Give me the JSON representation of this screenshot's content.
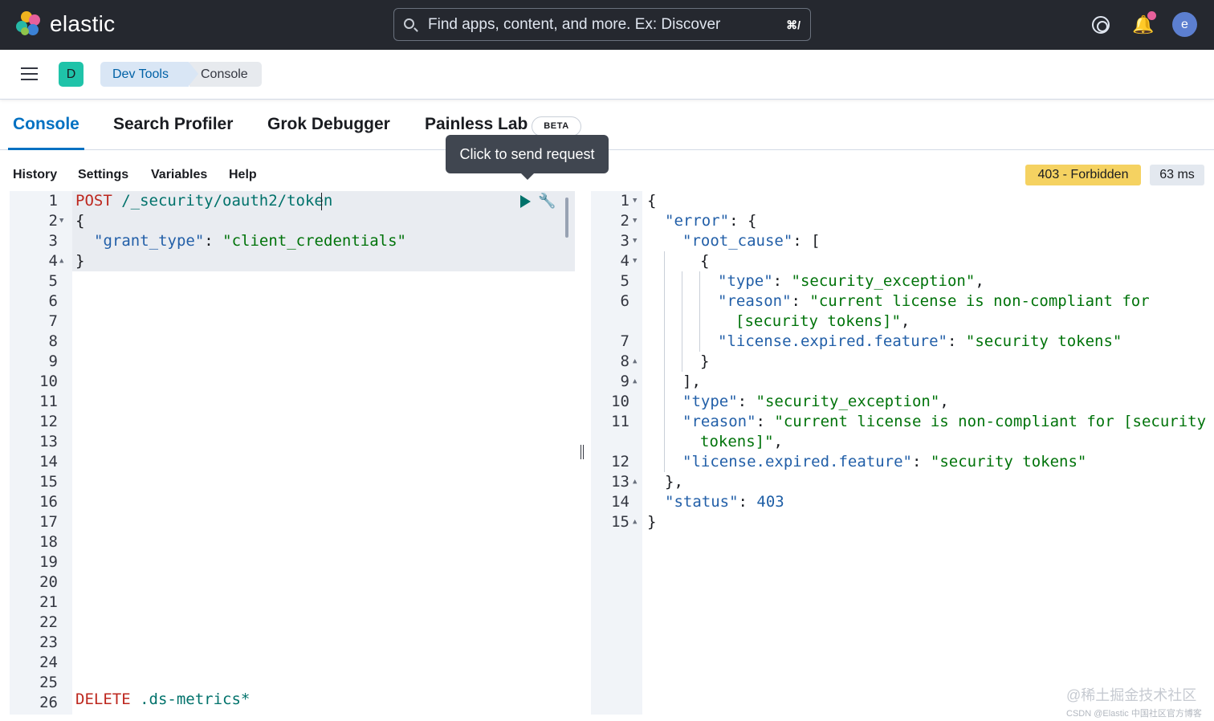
{
  "header": {
    "brand": "elastic",
    "search_placeholder": "Find apps, content, and more. Ex: Discover",
    "search_shortcut": "⌘/",
    "avatar_initial": "e"
  },
  "breadcrumbs": {
    "space_initial": "D",
    "items": [
      "Dev Tools",
      "Console"
    ]
  },
  "tabs": [
    {
      "label": "Console",
      "active": true
    },
    {
      "label": "Search Profiler",
      "active": false
    },
    {
      "label": "Grok Debugger",
      "active": false
    },
    {
      "label": "Painless Lab",
      "active": false,
      "badge": "BETA"
    }
  ],
  "tooltip": "Click to send request",
  "console_menu": [
    "History",
    "Settings",
    "Variables",
    "Help"
  ],
  "response_status": {
    "label": "403 - Forbidden",
    "time": "63 ms"
  },
  "request_editor": {
    "line_numbers": [
      "1",
      "2",
      "3",
      "4",
      "5",
      "6",
      "7",
      "8",
      "9",
      "10",
      "11",
      "12",
      "13",
      "14",
      "15",
      "16",
      "17",
      "18",
      "19",
      "20",
      "21",
      "22",
      "23",
      "24",
      "25",
      "26"
    ],
    "lines": {
      "l1_method": "POST",
      "l1_url": "/_security/oauth2/token",
      "l2": "{",
      "l3_key": "\"grant_type\"",
      "l3_colon": ": ",
      "l3_value": "\"client_credentials\"",
      "l4": "}",
      "l26_method": "DELETE",
      "l26_url": ".ds-metrics*"
    }
  },
  "response_editor": {
    "line_numbers": [
      "1",
      "2",
      "3",
      "4",
      "5",
      "6",
      "",
      "7",
      "8",
      "9",
      "10",
      "11",
      "",
      "12",
      "13",
      "14",
      "15"
    ],
    "lines": [
      [
        [
          "p",
          "{"
        ]
      ],
      [
        [
          "k",
          "\"error\""
        ],
        [
          "p",
          ": {"
        ]
      ],
      [
        [
          "k",
          "\"root_cause\""
        ],
        [
          "p",
          ": ["
        ]
      ],
      [
        [
          "p",
          "{"
        ]
      ],
      [
        [
          "k",
          "\"type\""
        ],
        [
          "p",
          ": "
        ],
        [
          "s",
          "\"security_exception\""
        ],
        [
          "p",
          ","
        ]
      ],
      [
        [
          "k",
          "\"reason\""
        ],
        [
          "p",
          ": "
        ],
        [
          "s",
          "\"current license is non-compliant for"
        ]
      ],
      [
        [
          "s",
          "[security tokens]\""
        ],
        [
          "p",
          ","
        ]
      ],
      [
        [
          "k",
          "\"license.expired.feature\""
        ],
        [
          "p",
          ": "
        ],
        [
          "s",
          "\"security tokens\""
        ]
      ],
      [
        [
          "p",
          "}"
        ]
      ],
      [
        [
          "p",
          "],"
        ]
      ],
      [
        [
          "k",
          "\"type\""
        ],
        [
          "p",
          ": "
        ],
        [
          "s",
          "\"security_exception\""
        ],
        [
          "p",
          ","
        ]
      ],
      [
        [
          "k",
          "\"reason\""
        ],
        [
          "p",
          ": "
        ],
        [
          "s",
          "\"current license is non-compliant for [security"
        ]
      ],
      [
        [
          "s",
          "tokens]\""
        ],
        [
          "p",
          ","
        ]
      ],
      [
        [
          "k",
          "\"license.expired.feature\""
        ],
        [
          "p",
          ": "
        ],
        [
          "s",
          "\"security tokens\""
        ]
      ],
      [
        [
          "p",
          "},"
        ]
      ],
      [
        [
          "k",
          "\"status\""
        ],
        [
          "p",
          ": "
        ],
        [
          "n",
          "403"
        ]
      ],
      [
        [
          "p",
          "}"
        ]
      ]
    ]
  },
  "watermark": {
    "main": "@稀土掘金技术社区",
    "sub": "CSDN @Elastic 中国社区官方博客"
  },
  "colors": {
    "header_bg": "#25282f",
    "accent": "#0071c2",
    "status_warning": "#f5d261",
    "space_badge": "#1fc3a9"
  }
}
